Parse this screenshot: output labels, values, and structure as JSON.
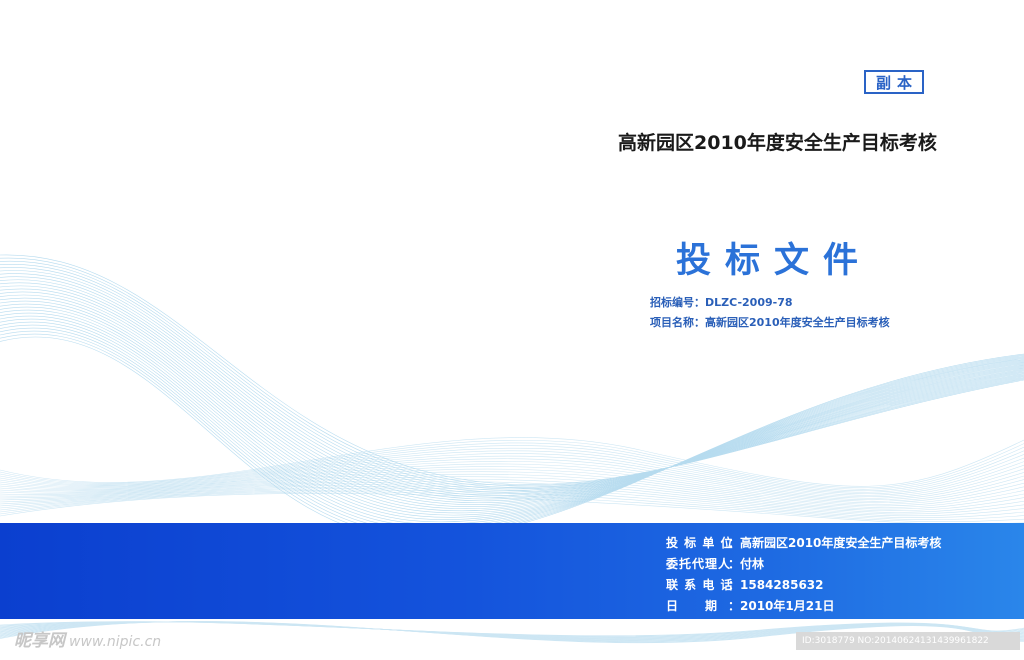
{
  "badge": {
    "copy": "副本"
  },
  "header": {
    "title": "高新园区2010年度安全生产目标考核"
  },
  "main": {
    "title": "投标文件"
  },
  "info": {
    "bid_number_label": "招标编号：",
    "bid_number_value": "DLZC-2009-78",
    "project_name_label": "项目名称：",
    "project_name_value": "高新园区2010年度安全生产目标考核"
  },
  "footer": {
    "rows": [
      {
        "label": "投 标 单 位",
        "value": "：高新园区2010年度安全生产目标考核"
      },
      {
        "label": "委托代理人",
        "value": "：付林"
      },
      {
        "label": "联 系 电 话",
        "value": "：1584285632"
      },
      {
        "label": "日　　期",
        "value": "：2010年1月21日"
      }
    ]
  },
  "watermark": {
    "brand": "昵享网",
    "url": "www.nipic.cn"
  },
  "image_id": {
    "text": "ID:3018779 NO:20140624131439961822"
  },
  "colors": {
    "accent": "#2b72d8",
    "band_start": "#0b3fcf",
    "band_end": "#2a86ea",
    "wave": "#9fd0ea"
  }
}
